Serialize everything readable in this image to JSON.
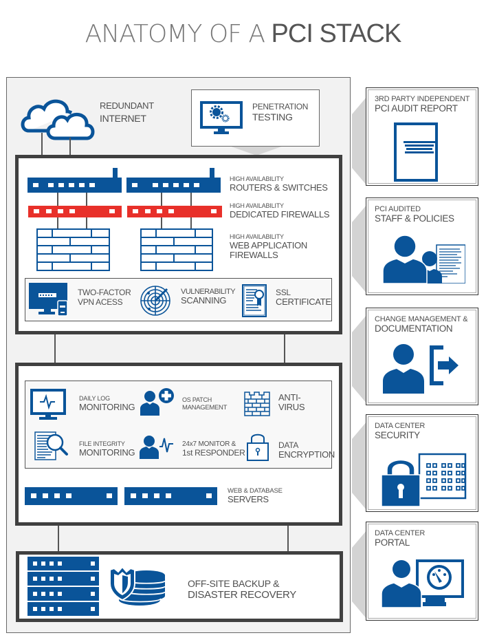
{
  "title": {
    "light": "ANATOMY OF A",
    "bold": "PCI STACK"
  },
  "colors": {
    "brand_blue": "#0a5499",
    "firewall_red": "#e8302a",
    "frame_dark": "#404040",
    "panel_gray": "#f2f2f2"
  },
  "top": {
    "internet": {
      "line1": "REDUNDANT",
      "line2": "INTERNET",
      "icon": "cloud-icon"
    },
    "pentest": {
      "line1": "PENETRATION",
      "line2": "TESTING",
      "icon": "monitor-gears-icon"
    }
  },
  "network_layer": {
    "routers": {
      "small": "HIGH AVAILABILITY",
      "big": "ROUTERS & SWITCHES"
    },
    "firewalls": {
      "small": "HIGH AVAILABILITY",
      "big": "DEDICATED FIREWALLS"
    },
    "waf": {
      "small": "HIGH AVAILABILITY",
      "big1": "WEB APPLICATION",
      "big2": "FIREWALLS"
    },
    "services": [
      {
        "line1": "TWO-FACTOR",
        "line2": "VPN ACESS",
        "icon": "vpn-monitor-icon"
      },
      {
        "line1": "VULNERABILITY",
        "line2": "SCANNING",
        "icon": "radar-icon"
      },
      {
        "line1": "SSL",
        "line2": "CERTIFICATE",
        "icon": "certificate-icon"
      }
    ]
  },
  "server_layer": {
    "services": [
      {
        "small": "DAILY LOG",
        "big": "MONITORING",
        "icon": "heartbeat-monitor-icon"
      },
      {
        "small": "OS PATCH",
        "big": "MANAGEMENT",
        "icon": "user-plus-icon"
      },
      {
        "small": "ANTI-",
        "big": "VIRUS",
        "icon": "brick-wall-icon"
      },
      {
        "small": "FILE INTEGRITY",
        "big": "MONITORING",
        "icon": "file-search-icon"
      },
      {
        "small": "24x7 MONITOR &",
        "big": "1st RESPONDER",
        "icon": "user-heartbeat-icon"
      },
      {
        "small": "DATA",
        "big": "ENCRYPTION",
        "icon": "padlock-icon"
      }
    ],
    "servers": {
      "small": "WEB & DATABASE",
      "big": "SERVERS"
    }
  },
  "backup": {
    "line1": "OFF-SITE BACKUP &",
    "line2": "DISASTER RECOVERY"
  },
  "side_cards": [
    {
      "small": "3RD PARTY INDEPENDENT",
      "big": "PCI AUDIT REPORT",
      "icon": "report-document-icon"
    },
    {
      "small": "PCI AUDITED",
      "big": "STAFF & POLICIES",
      "icon": "staff-policies-icon"
    },
    {
      "small": "CHANGE MANAGEMENT &",
      "big": "DOCUMENTATION",
      "icon": "user-exit-icon"
    },
    {
      "small": "DATA CENTER",
      "big": "SECURITY",
      "icon": "datacenter-lock-icon"
    },
    {
      "small": "DATA CENTER",
      "big": "PORTAL",
      "icon": "user-dashboard-icon"
    }
  ]
}
